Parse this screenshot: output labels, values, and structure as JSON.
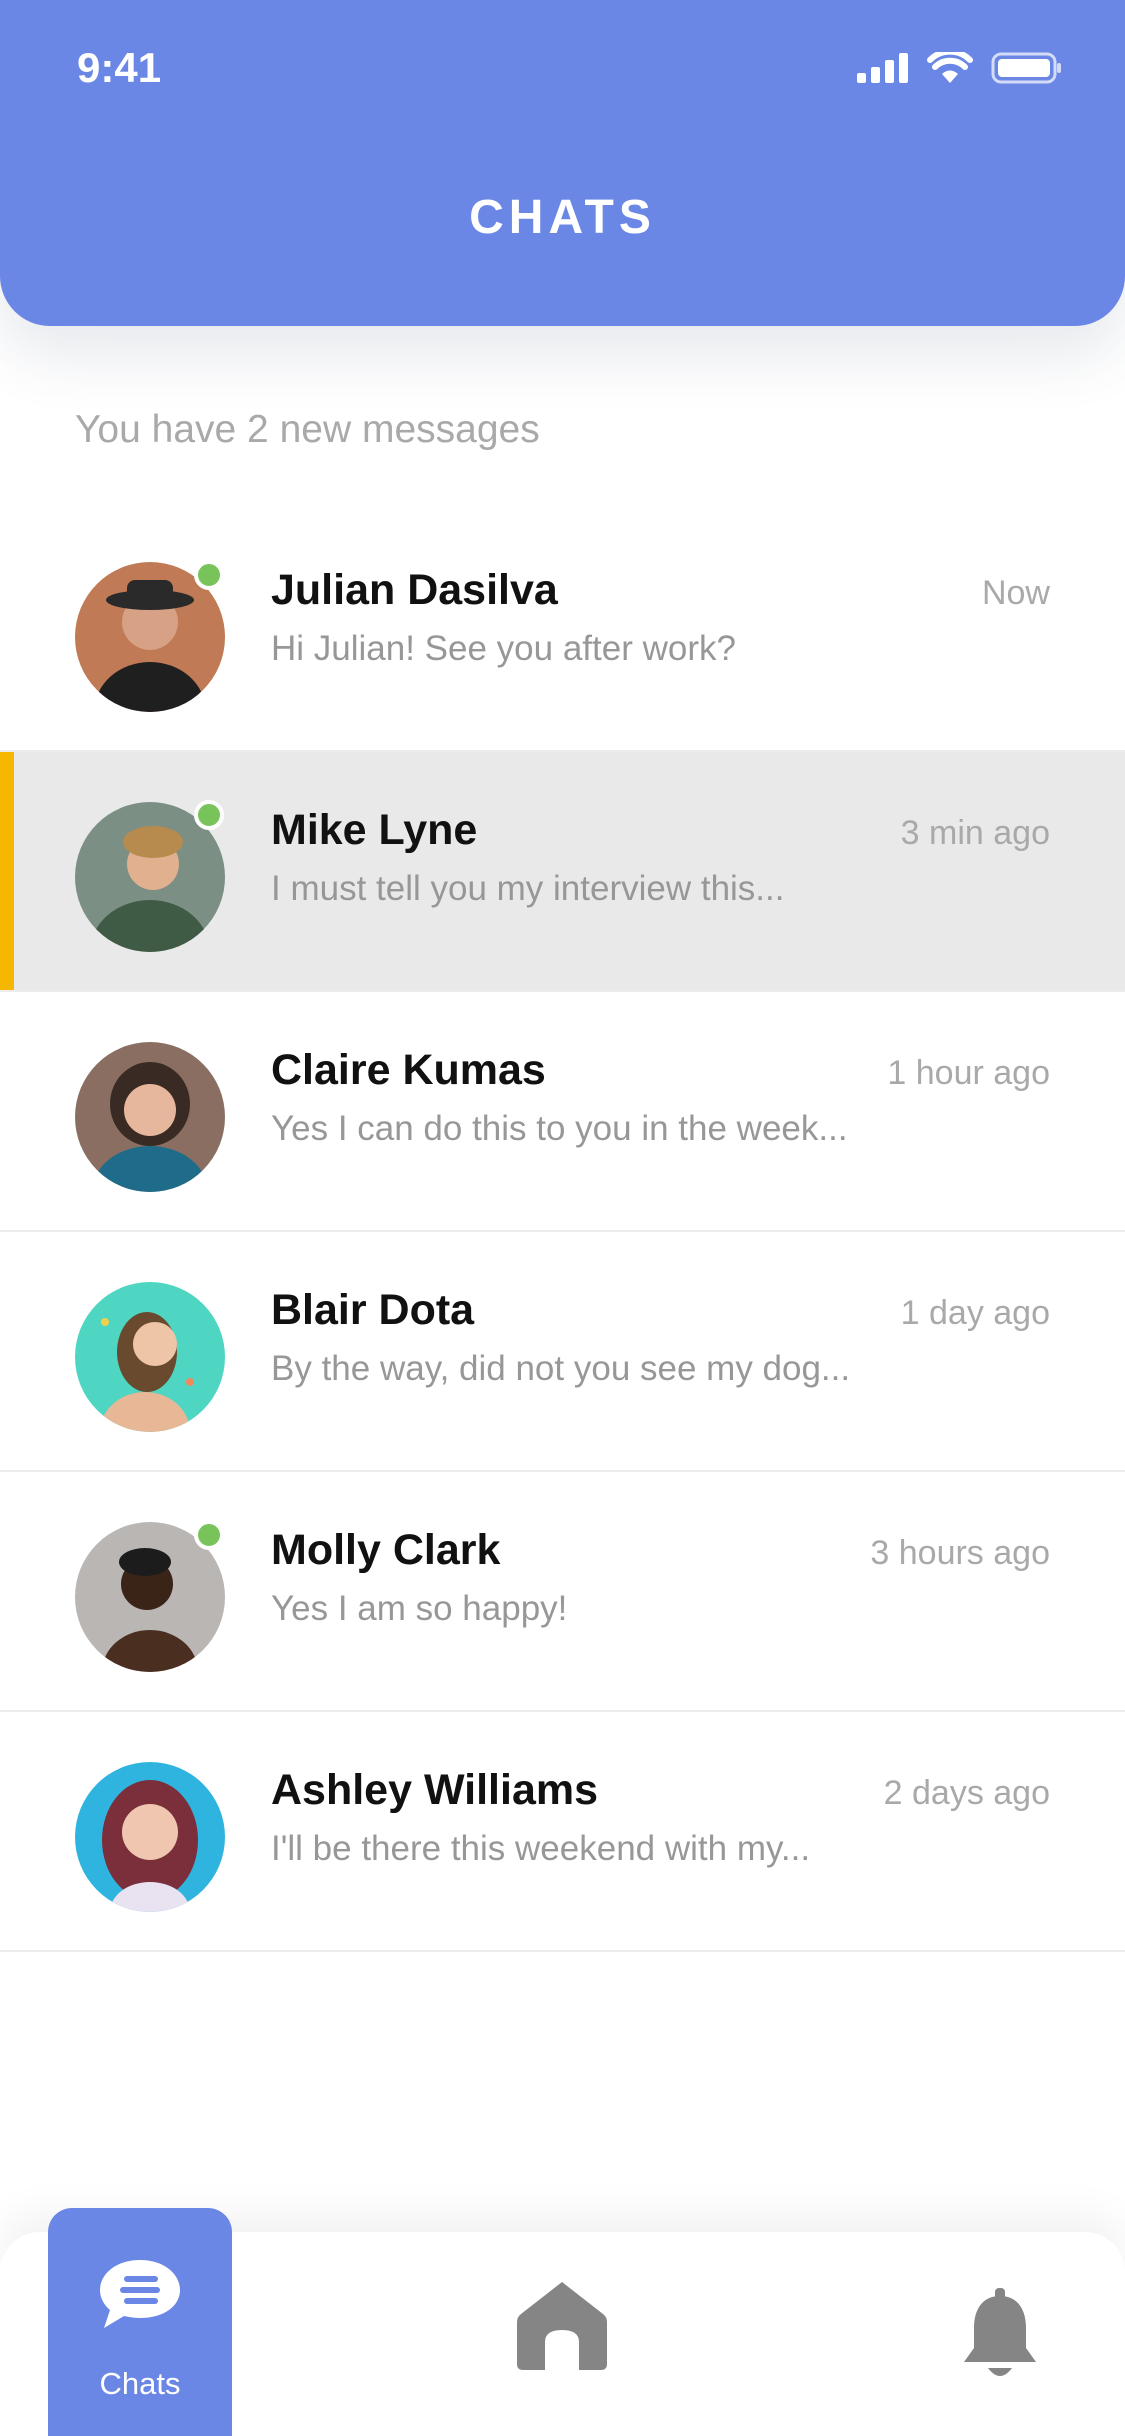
{
  "status": {
    "time": "9:41"
  },
  "header": {
    "title": "CHATS"
  },
  "summary": "You have 2 new messages",
  "chats": [
    {
      "name": "Julian Dasilva",
      "preview": "Hi Julian! See you after work?",
      "time": "Now",
      "online": true,
      "selected": false,
      "avatar_color": "#c07a55"
    },
    {
      "name": "Mike Lyne",
      "preview": "I must tell you my interview this...",
      "time": "3 min ago",
      "online": true,
      "selected": true,
      "avatar_color": "#5a7a6a"
    },
    {
      "name": "Claire Kumas",
      "preview": "Yes I can do this to you in the week...",
      "time": "1 hour ago",
      "online": false,
      "selected": false,
      "avatar_color": "#8a6e62"
    },
    {
      "name": "Blair Dota",
      "preview": "By the way, did not you see my dog...",
      "time": "1 day ago",
      "online": false,
      "selected": false,
      "avatar_color": "#4fd6c3"
    },
    {
      "name": "Molly Clark",
      "preview": "Yes I am so happy!",
      "time": "3 hours ago",
      "online": true,
      "selected": false,
      "avatar_color": "#b9b6b4"
    },
    {
      "name": "Ashley Williams",
      "preview": "I'll be there this weekend with my...",
      "time": "2 days ago",
      "online": false,
      "selected": false,
      "avatar_color": "#a24d5a"
    }
  ],
  "nav": {
    "chats_label": "Chats"
  },
  "colors": {
    "accent": "#6b87e6",
    "selected_bar": "#f5b700",
    "online": "#79c45a"
  }
}
